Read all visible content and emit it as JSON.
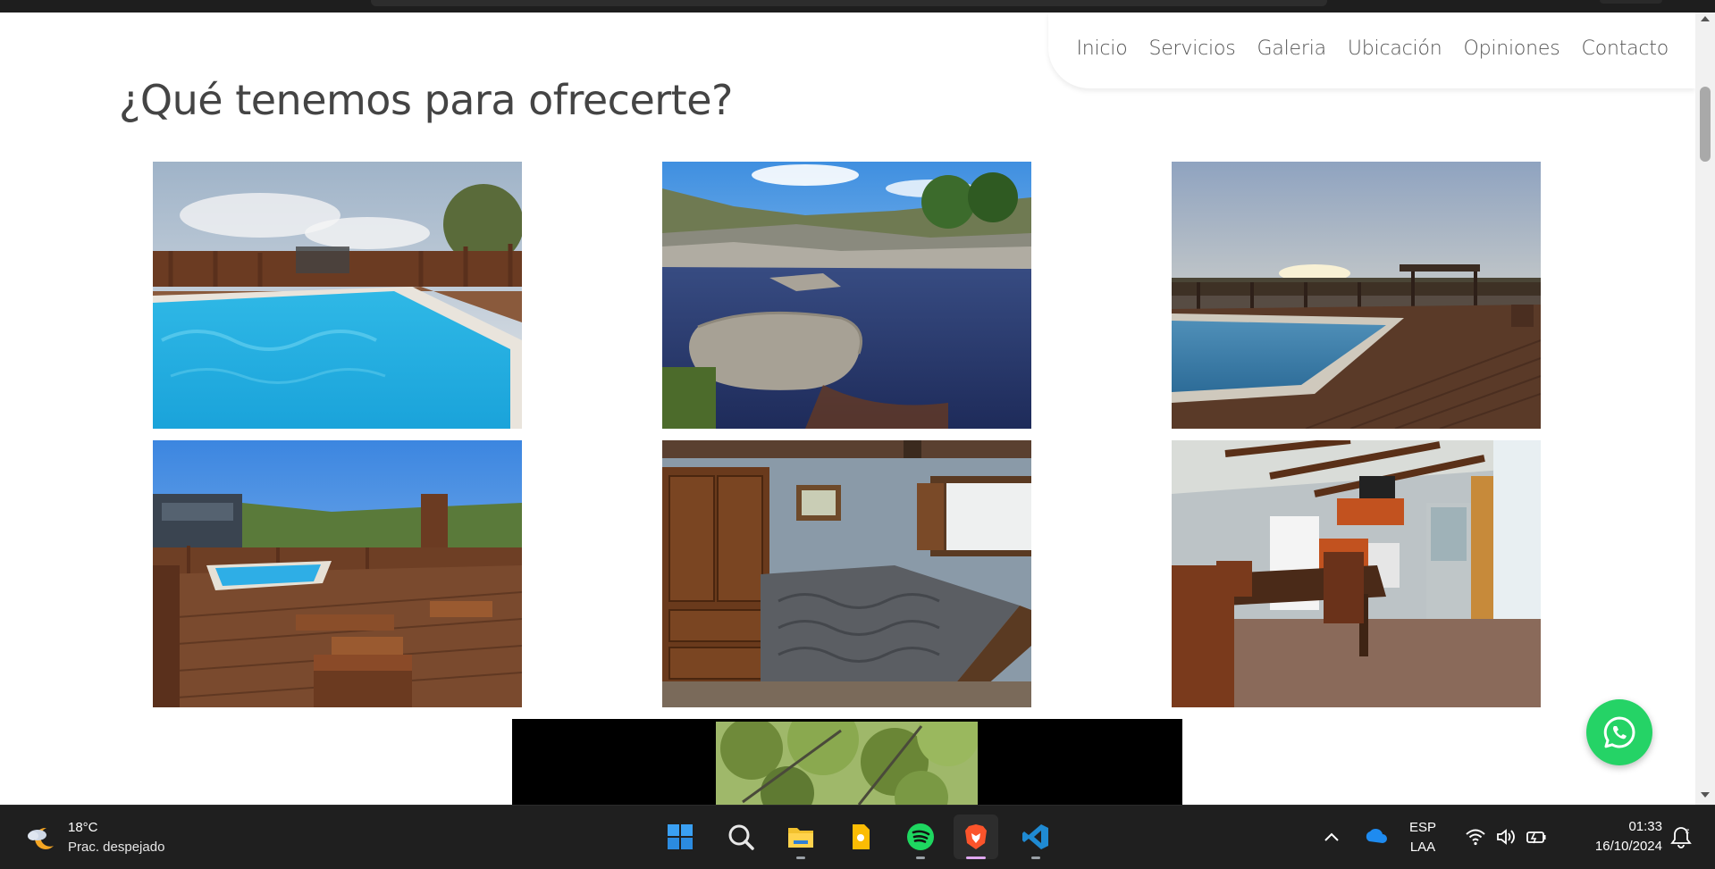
{
  "nav": {
    "items": [
      {
        "label": "Inicio"
      },
      {
        "label": "Servicios"
      },
      {
        "label": "Galeria"
      },
      {
        "label": "Ubicación"
      },
      {
        "label": "Opiniones"
      },
      {
        "label": "Contacto"
      }
    ]
  },
  "section": {
    "title": "¿Qué tenemos para ofrecerte?"
  },
  "gallery": {
    "photos": [
      {
        "subject": "pool-with-wooden-railing"
      },
      {
        "subject": "river-with-rocks"
      },
      {
        "subject": "pool-deck-sunset"
      },
      {
        "subject": "deck-with-lounge-chairs"
      },
      {
        "subject": "bedroom-with-wardrobe"
      },
      {
        "subject": "kitchen-dining-room"
      }
    ]
  },
  "floating": {
    "whatsapp_icon": "whatsapp-icon"
  },
  "taskbar": {
    "weather": {
      "temp": "18°C",
      "condition": "Prac. despejado"
    },
    "apps": [
      "windows-start-icon",
      "search-icon",
      "file-explorer-icon",
      "notes-icon",
      "spotify-icon",
      "brave-browser-icon",
      "vscode-icon"
    ],
    "language": {
      "line1": "ESP",
      "line2": "LAA"
    },
    "clock": {
      "time": "01:33",
      "date": "16/10/2024"
    }
  },
  "colors": {
    "nav_text": "#555555",
    "title_text": "#444444",
    "whatsapp_green": "#25d366",
    "taskbar_bg": "#1f1f1f"
  }
}
